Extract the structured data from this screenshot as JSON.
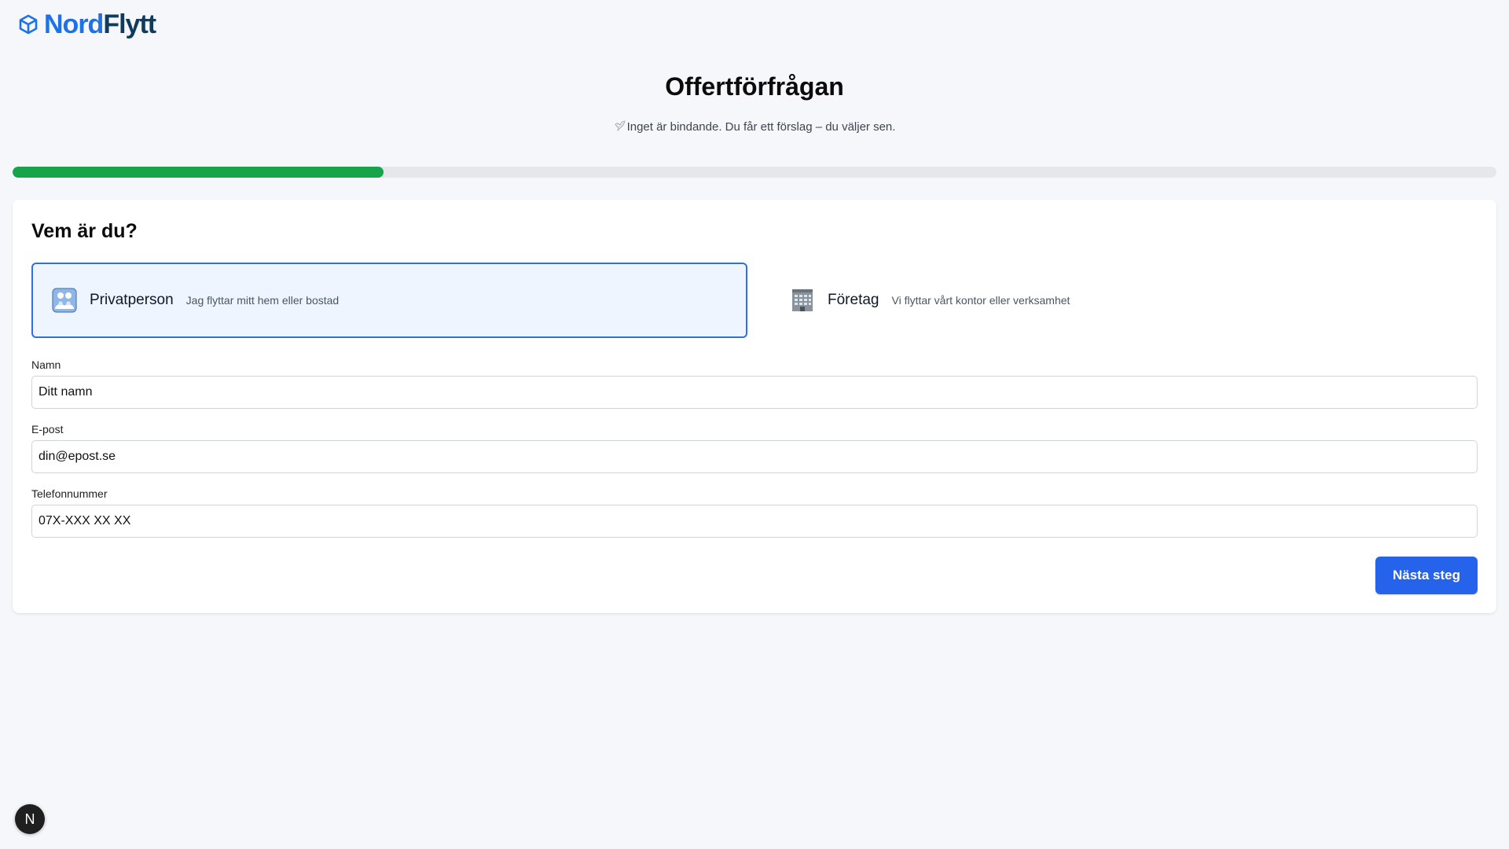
{
  "brand": {
    "part1": "Nord",
    "part2": "Flytt",
    "icon": "box-icon"
  },
  "header": {
    "title": "Offertförfrågan",
    "subtitle": "Inget är bindande. Du får ett förslag – du väljer sen.",
    "subtitle_icon": "dove-icon"
  },
  "progress": {
    "fraction": 0.25,
    "color": "#16a34a"
  },
  "form": {
    "heading": "Vem är du?",
    "customer_types": [
      {
        "label": "Privatperson",
        "description": "Jag flyttar mitt hem eller bostad",
        "icon": "family-icon",
        "selected": true
      },
      {
        "label": "Företag",
        "description": "Vi flyttar vårt kontor eller verksamhet",
        "icon": "office-building-icon",
        "selected": false
      }
    ],
    "fields": [
      {
        "label": "Namn",
        "placeholder": "Ditt namn"
      },
      {
        "label": "E-post",
        "placeholder": "din@epost.se"
      },
      {
        "label": "Telefonnummer",
        "placeholder": "07X-XXX XX XX"
      }
    ],
    "next_label": "Nästa steg"
  },
  "devtools_badge": {
    "label": "N"
  },
  "colors": {
    "accent": "#2563eb",
    "selected_bg": "#eef5ff",
    "selected_border": "#2f6fe4",
    "brand_blue": "#1d72e8",
    "brand_dark": "#0f3b5c"
  }
}
